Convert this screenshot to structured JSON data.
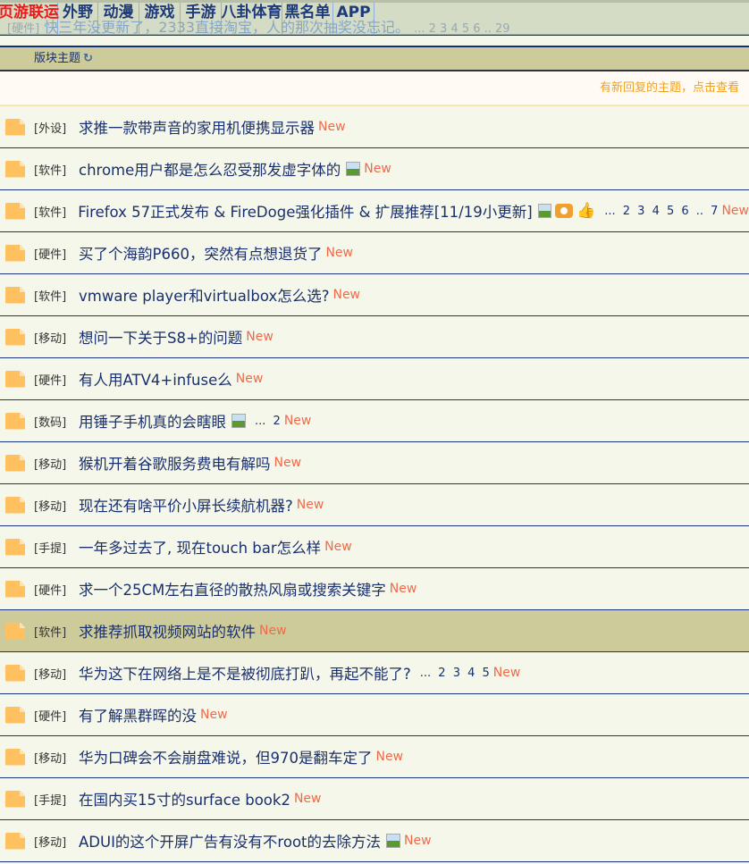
{
  "ghost_row": {
    "tag": "[硬件]",
    "title": "快三年没更新了，2333直接淘宝，人的那次抽奖没忘记。",
    "pages": "... 2 3 4 5 6 .. 29"
  },
  "nav": [
    "页游联运",
    "外野",
    "动漫",
    "游戏",
    "手游",
    "八卦体育",
    "黑名单",
    "APP"
  ],
  "section": {
    "title": "版块主题",
    "refresh_icon": "refresh-icon"
  },
  "notice": "有新回复的主题，点击查看",
  "new_label": "New",
  "rows": [
    {
      "tag": "[外设]",
      "title": "求推一款带声音的家用机便携显示器"
    },
    {
      "tag": "[软件]",
      "title": "chrome用户都是怎么忍受那发虚字体的",
      "image": true
    },
    {
      "tag": "[软件]",
      "title": "Firefox 57正式发布 & FireDoge强化插件 & 扩展推荐[11/19小更新]",
      "image": true,
      "camera": true,
      "thumb": true,
      "pages": "... 2 3 4 5 6 .. 7"
    },
    {
      "tag": "[硬件]",
      "title": "买了个海韵P660，突然有点想退货了"
    },
    {
      "tag": "[软件]",
      "title": "vmware player和virtualbox怎么选?"
    },
    {
      "tag": "[移动]",
      "title": "想问一下关于S8+的问题"
    },
    {
      "tag": "[硬件]",
      "title": "有人用ATV4+infuse么"
    },
    {
      "tag": "[数码]",
      "title": "用锤子手机真的会瞎眼",
      "image": true,
      "pages": "... 2"
    },
    {
      "tag": "[移动]",
      "title": "猴机开着谷歌服务费电有解吗"
    },
    {
      "tag": "[移动]",
      "title": "现在还有啥平价小屏长续航机器?"
    },
    {
      "tag": "[手提]",
      "title": "一年多过去了, 现在touch bar怎么样"
    },
    {
      "tag": "[硬件]",
      "title": "求一个25CM左右直径的散热风扇或搜索关键字"
    },
    {
      "tag": "[软件]",
      "title": "求推荐抓取视频网站的软件",
      "highlighted": true
    },
    {
      "tag": "[移动]",
      "title": "华为这下在网络上是不是被彻底打趴，再起不能了?",
      "pages": "... 2 3 4 5"
    },
    {
      "tag": "[硬件]",
      "title": "有了解黑群晖的没"
    },
    {
      "tag": "[移动]",
      "title": "华为口碑会不会崩盘难说，但970是翻车定了"
    },
    {
      "tag": "[手提]",
      "title": "在国内买15寸的surface book2"
    },
    {
      "tag": "[移动]",
      "title": "ADUI的这个开屏广告有没有不root的去除方法",
      "image": true
    }
  ],
  "colors": {
    "accent": "#f01818",
    "link": "#1a2f6e",
    "new": "#f06a4a",
    "section_bg": "#cccb99",
    "notice": "#f0a020"
  }
}
